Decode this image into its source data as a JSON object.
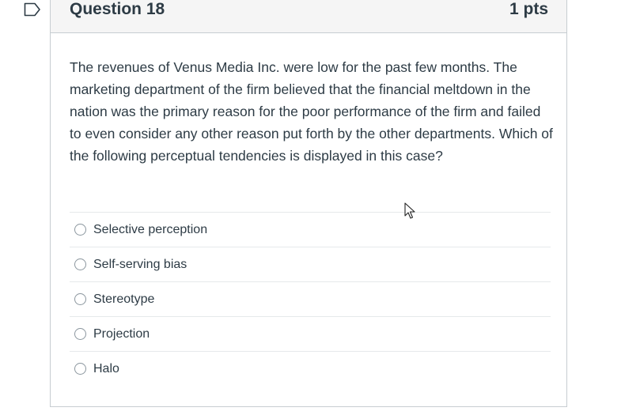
{
  "question": {
    "title": "Question 18",
    "points": "1 pts",
    "text": "The revenues of Venus Media Inc. were low for the past few months. The marketing department of the firm believed that the financial meltdown in the nation was the primary reason for the poor performance of the firm and failed to even consider any other reason put forth by the other departments. Which of the following perceptual tendencies is displayed in this case?"
  },
  "answers": [
    {
      "label": "Selective perception"
    },
    {
      "label": "Self-serving bias"
    },
    {
      "label": "Stereotype"
    },
    {
      "label": "Projection"
    },
    {
      "label": "Halo"
    }
  ],
  "icons": {
    "flag": "bookmark-flag-icon",
    "cursor": "mouse-pointer-icon"
  },
  "colors": {
    "text": "#2d3b45",
    "header_bg": "#f5f5f5",
    "border": "#c7cdd1"
  }
}
